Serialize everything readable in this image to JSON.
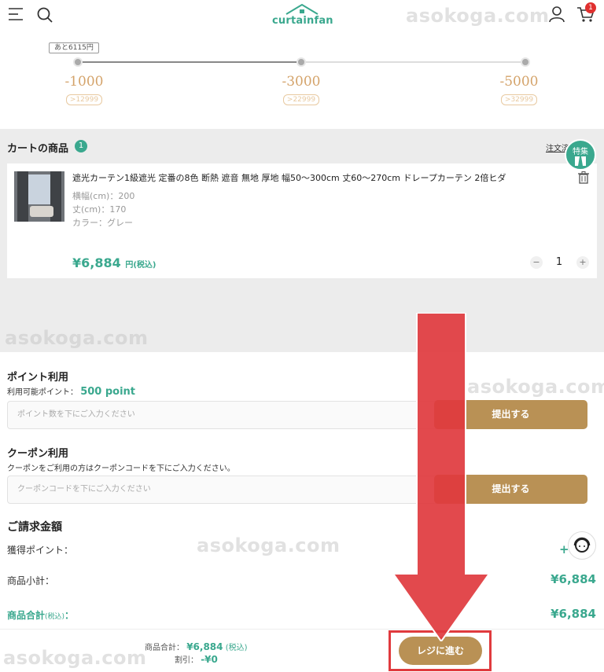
{
  "header": {
    "logo_text": "curtainfan",
    "cart_badge": "1"
  },
  "watermark": "asokoga.com",
  "progress": {
    "remaining_label": "あと6115円",
    "fill_fraction": 0.5,
    "tiers": [
      {
        "amount": "-1000",
        "min": ">12999"
      },
      {
        "amount": "-3000",
        "min": ">22999"
      },
      {
        "amount": "-5000",
        "min": ">32999"
      }
    ]
  },
  "cart": {
    "title": "カートの商品",
    "count": "1",
    "history_link": "注文済",
    "feature_badge": "特集",
    "item": {
      "name": "遮光カーテン1級遮光 定番の8色 断熱 遮音 無地 厚地 幅50～300cm 丈60～270cm ドレープカーテン 2倍ヒダ",
      "width": "横幅(cm)：200",
      "height": "丈(cm)：170",
      "color": "カラー：グレー",
      "price": "¥6,884",
      "price_suffix": "円(税込)",
      "quantity": "1",
      "minus": "−",
      "plus": "+"
    }
  },
  "points": {
    "title": "ポイント利用",
    "available_label": "利用可能ポイント：",
    "available_value": "500 point",
    "placeholder": "ポイント数を下にご入力ください",
    "submit": "提出する"
  },
  "coupon": {
    "title": "クーポン利用",
    "subtitle": "クーポンをご利用の方はクーポンコードを下にご入力ください。",
    "placeholder": "クーポンコードを下にご入力ください",
    "submit": "提出する"
  },
  "billing": {
    "title": "ご請求金額",
    "earned_label": "獲得ポイント：",
    "earned_value": "+6",
    "subtotal_label": "商品小計：",
    "subtotal_value": "¥6,884",
    "total_label": "商品合計",
    "total_label_tax": "(税込)",
    "total_label_colon": "：",
    "total_value": "¥6,884"
  },
  "footer": {
    "total_label": "商品合計：",
    "total_value": "¥6,884",
    "total_tax": "(税込)",
    "discount_label": "割引：",
    "discount_value": "-¥0",
    "checkout": "レジに進む"
  },
  "colors": {
    "accent": "#3aa88e",
    "button": "#b99155",
    "arrow": "#e03a3e"
  }
}
